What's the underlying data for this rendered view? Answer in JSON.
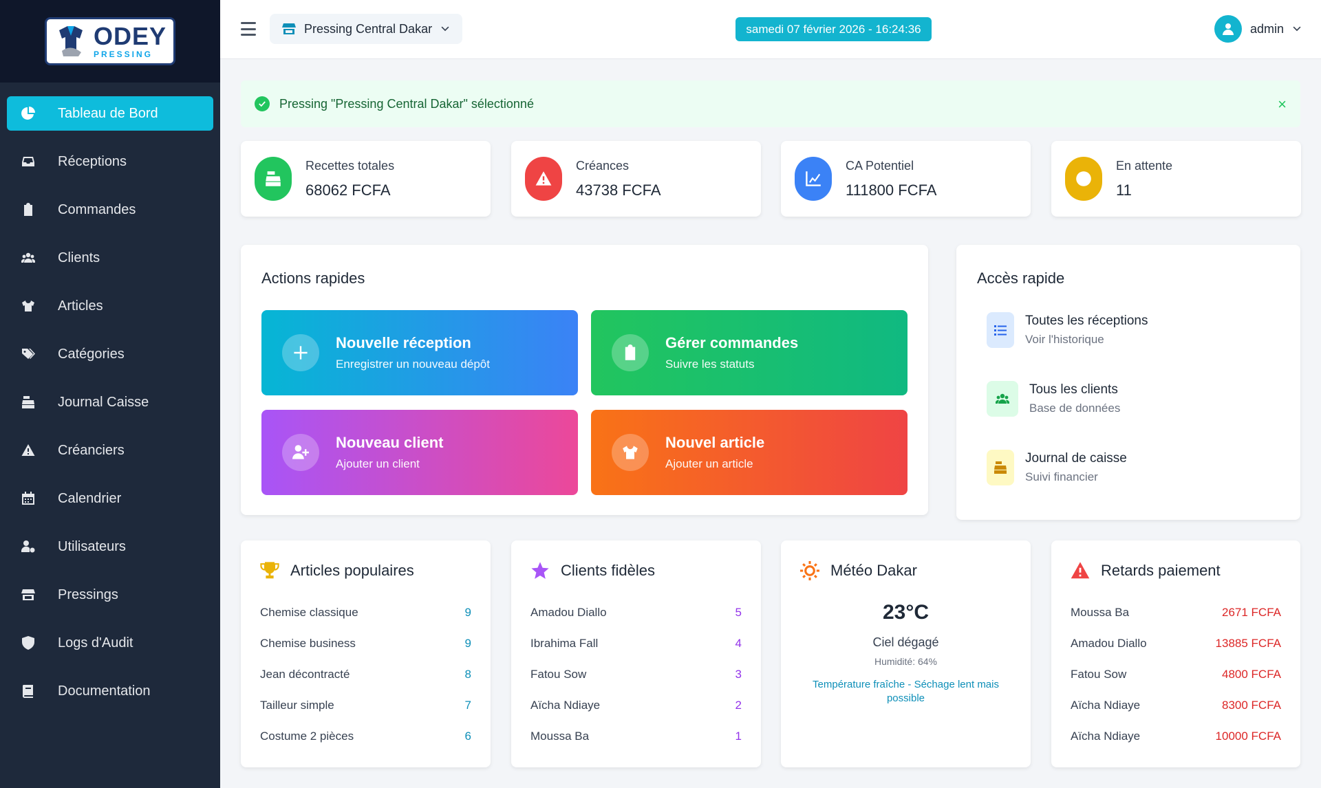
{
  "brand": {
    "name": "ODEY",
    "sub": "PRESSING"
  },
  "sidebar": {
    "items": [
      {
        "label": "Tableau de Bord",
        "icon": "pie-chart-icon",
        "active": true
      },
      {
        "label": "Réceptions",
        "icon": "inbox-icon"
      },
      {
        "label": "Commandes",
        "icon": "clipboard-icon"
      },
      {
        "label": "Clients",
        "icon": "users-icon"
      },
      {
        "label": "Articles",
        "icon": "shirt-icon"
      },
      {
        "label": "Catégories",
        "icon": "tags-icon"
      },
      {
        "label": "Journal Caisse",
        "icon": "cash-register-icon"
      },
      {
        "label": "Créanciers",
        "icon": "warning-icon"
      },
      {
        "label": "Calendrier",
        "icon": "calendar-icon"
      },
      {
        "label": "Utilisateurs",
        "icon": "user-gear-icon"
      },
      {
        "label": "Pressings",
        "icon": "store-icon"
      },
      {
        "label": "Logs d'Audit",
        "icon": "shield-icon"
      },
      {
        "label": "Documentation",
        "icon": "book-icon"
      }
    ]
  },
  "header": {
    "store": "Pressing Central Dakar",
    "datetime": "samedi 07 février 2026 - 16:24:36",
    "user": "admin"
  },
  "alert": {
    "text": "Pressing \"Pressing Central Dakar\" sélectionné",
    "close": "×"
  },
  "stats": [
    {
      "label": "Recettes totales",
      "value": "68062 FCFA",
      "color": "#22c55e",
      "icon": "cash-register-icon"
    },
    {
      "label": "Créances",
      "value": "43738 FCFA",
      "color": "#ef4444",
      "icon": "warning-icon"
    },
    {
      "label": "CA Potentiel",
      "value": "111800 FCFA",
      "color": "#3b82f6",
      "icon": "chart-line-icon"
    },
    {
      "label": "En attente",
      "value": "11",
      "color": "#eab308",
      "icon": "clock-icon"
    }
  ],
  "actions": {
    "title": "Actions rapides",
    "items": [
      {
        "title": "Nouvelle réception",
        "sub": "Enregistrer un nouveau dépôt",
        "icon": "plus-icon"
      },
      {
        "title": "Gérer commandes",
        "sub": "Suivre les statuts",
        "icon": "clipboard-icon"
      },
      {
        "title": "Nouveau client",
        "sub": "Ajouter un client",
        "icon": "user-plus-icon"
      },
      {
        "title": "Nouvel article",
        "sub": "Ajouter un article",
        "icon": "shirt-icon"
      }
    ]
  },
  "quick_access": {
    "title": "Accès rapide",
    "items": [
      {
        "title": "Toutes les réceptions",
        "sub": "Voir l'historique",
        "icon": "list-icon"
      },
      {
        "title": "Tous les clients",
        "sub": "Base de données",
        "icon": "users-icon"
      },
      {
        "title": "Journal de caisse",
        "sub": "Suivi financier",
        "icon": "cash-register-icon"
      }
    ]
  },
  "popular": {
    "title": "Articles populaires",
    "items": [
      {
        "name": "Chemise classique",
        "value": "9"
      },
      {
        "name": "Chemise business",
        "value": "9"
      },
      {
        "name": "Jean décontracté",
        "value": "8"
      },
      {
        "name": "Tailleur simple",
        "value": "7"
      },
      {
        "name": "Costume 2 pièces",
        "value": "6"
      }
    ]
  },
  "loyal": {
    "title": "Clients fidèles",
    "items": [
      {
        "name": "Amadou Diallo",
        "value": "5"
      },
      {
        "name": "Ibrahima Fall",
        "value": "4"
      },
      {
        "name": "Fatou Sow",
        "value": "3"
      },
      {
        "name": "Aïcha Ndiaye",
        "value": "2"
      },
      {
        "name": "Moussa Ba",
        "value": "1"
      }
    ]
  },
  "weather": {
    "title": "Météo Dakar",
    "temp": "23°C",
    "desc": "Ciel dégagé",
    "humidity": "Humidité: 64%",
    "tip": "Température fraîche - Séchage lent mais possible"
  },
  "late": {
    "title": "Retards paiement",
    "items": [
      {
        "name": "Moussa Ba",
        "value": "2671 FCFA"
      },
      {
        "name": "Amadou Diallo",
        "value": "13885 FCFA"
      },
      {
        "name": "Fatou Sow",
        "value": "4800 FCFA"
      },
      {
        "name": "Aïcha Ndiaye",
        "value": "8300 FCFA"
      },
      {
        "name": "Aïcha Ndiaye",
        "value": "10000 FCFA"
      }
    ]
  }
}
